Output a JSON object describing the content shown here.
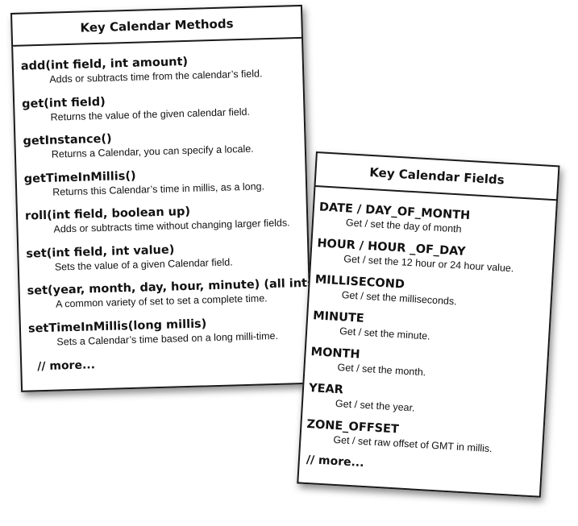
{
  "methods_card": {
    "title": "Key Calendar Methods",
    "items": [
      {
        "name": "add(int field, int amount)",
        "desc": "Adds or subtracts time from the calendar’s field."
      },
      {
        "name": "get(int field)",
        "desc": "Returns the value of the given calendar field."
      },
      {
        "name": "getInstance()",
        "desc": "Returns a Calendar, you can specify a locale."
      },
      {
        "name": "getTimeInMillis()",
        "desc": "Returns this Calendar’s time in millis, as a long."
      },
      {
        "name": "roll(int field, boolean up)",
        "desc": "Adds or subtracts time without changing larger fields."
      },
      {
        "name": "set(int field, int value)",
        "desc": "Sets the value of a given Calendar field."
      },
      {
        "name": "set(year, month, day, hour, minute)  (all ints)",
        "desc": "A common variety of set to set a complete time."
      },
      {
        "name": "setTimeInMillis(long millis)",
        "desc": "Sets a Calendar’s time based on a long milli-time."
      }
    ],
    "more": "// more..."
  },
  "fields_card": {
    "title": "Key Calendar Fields",
    "items": [
      {
        "name": "DATE  /  DAY_OF_MONTH",
        "desc": "Get / set the day of month"
      },
      {
        "name": "HOUR / HOUR _OF_DAY",
        "desc": "Get / set the 12 hour or 24 hour value."
      },
      {
        "name": "MILLISECOND",
        "desc": "Get / set the milliseconds."
      },
      {
        "name": "MINUTE",
        "desc": "Get / set the minute."
      },
      {
        "name": "MONTH",
        "desc": "Get / set the month."
      },
      {
        "name": "YEAR",
        "desc": "Get / set the year."
      },
      {
        "name": "ZONE_OFFSET",
        "desc": "Get / set raw offset of GMT in millis."
      }
    ],
    "more": "// more..."
  }
}
